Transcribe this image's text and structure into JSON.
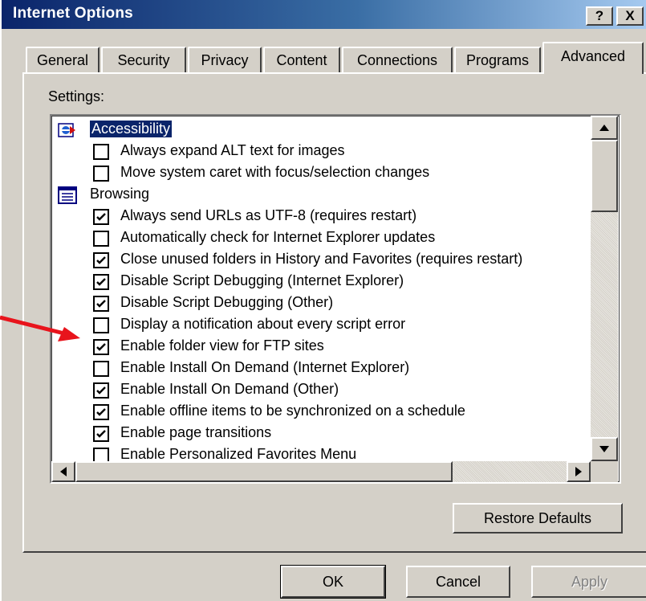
{
  "window": {
    "title": "Internet Options",
    "help_button": "?",
    "close_button": "X"
  },
  "tabs": [
    {
      "label": "General"
    },
    {
      "label": "Security"
    },
    {
      "label": "Privacy"
    },
    {
      "label": "Content"
    },
    {
      "label": "Connections"
    },
    {
      "label": "Programs"
    },
    {
      "label": "Advanced",
      "active": true
    }
  ],
  "settings_label": "Settings:",
  "settings": {
    "categories": {
      "accessibility": {
        "label": "Accessibility",
        "icon": "accessibility-icon",
        "selected": true
      },
      "browsing": {
        "label": "Browsing",
        "icon": "browsing-icon"
      }
    },
    "items": [
      {
        "label": "Always expand ALT text for images",
        "checked": false
      },
      {
        "label": "Move system caret with focus/selection changes",
        "checked": false
      },
      {
        "label": "Always send URLs as UTF-8 (requires restart)",
        "checked": true
      },
      {
        "label": "Automatically check for Internet Explorer updates",
        "checked": false
      },
      {
        "label": "Close unused folders in History and Favorites (requires restart)",
        "checked": true
      },
      {
        "label": "Disable Script Debugging (Internet Explorer)",
        "checked": true
      },
      {
        "label": "Disable Script Debugging (Other)",
        "checked": true
      },
      {
        "label": "Display a notification about every script error",
        "checked": false
      },
      {
        "label": "Enable folder view for FTP sites",
        "checked": true
      },
      {
        "label": "Enable Install On Demand (Internet Explorer)",
        "checked": false
      },
      {
        "label": "Enable Install On Demand (Other)",
        "checked": true
      },
      {
        "label": "Enable offline items to be synchronized on a schedule",
        "checked": true
      },
      {
        "label": "Enable page transitions",
        "checked": true
      },
      {
        "label": "Enable Personalized Favorites Menu",
        "checked": false
      }
    ]
  },
  "buttons": {
    "restore_defaults": "Restore Defaults",
    "ok": "OK",
    "cancel": "Cancel",
    "apply": "Apply"
  },
  "colors": {
    "title_bar": "#0a246a",
    "face": "#d4d0c8",
    "selection": "#0a246a",
    "annotation_arrow": "#e8141c"
  }
}
